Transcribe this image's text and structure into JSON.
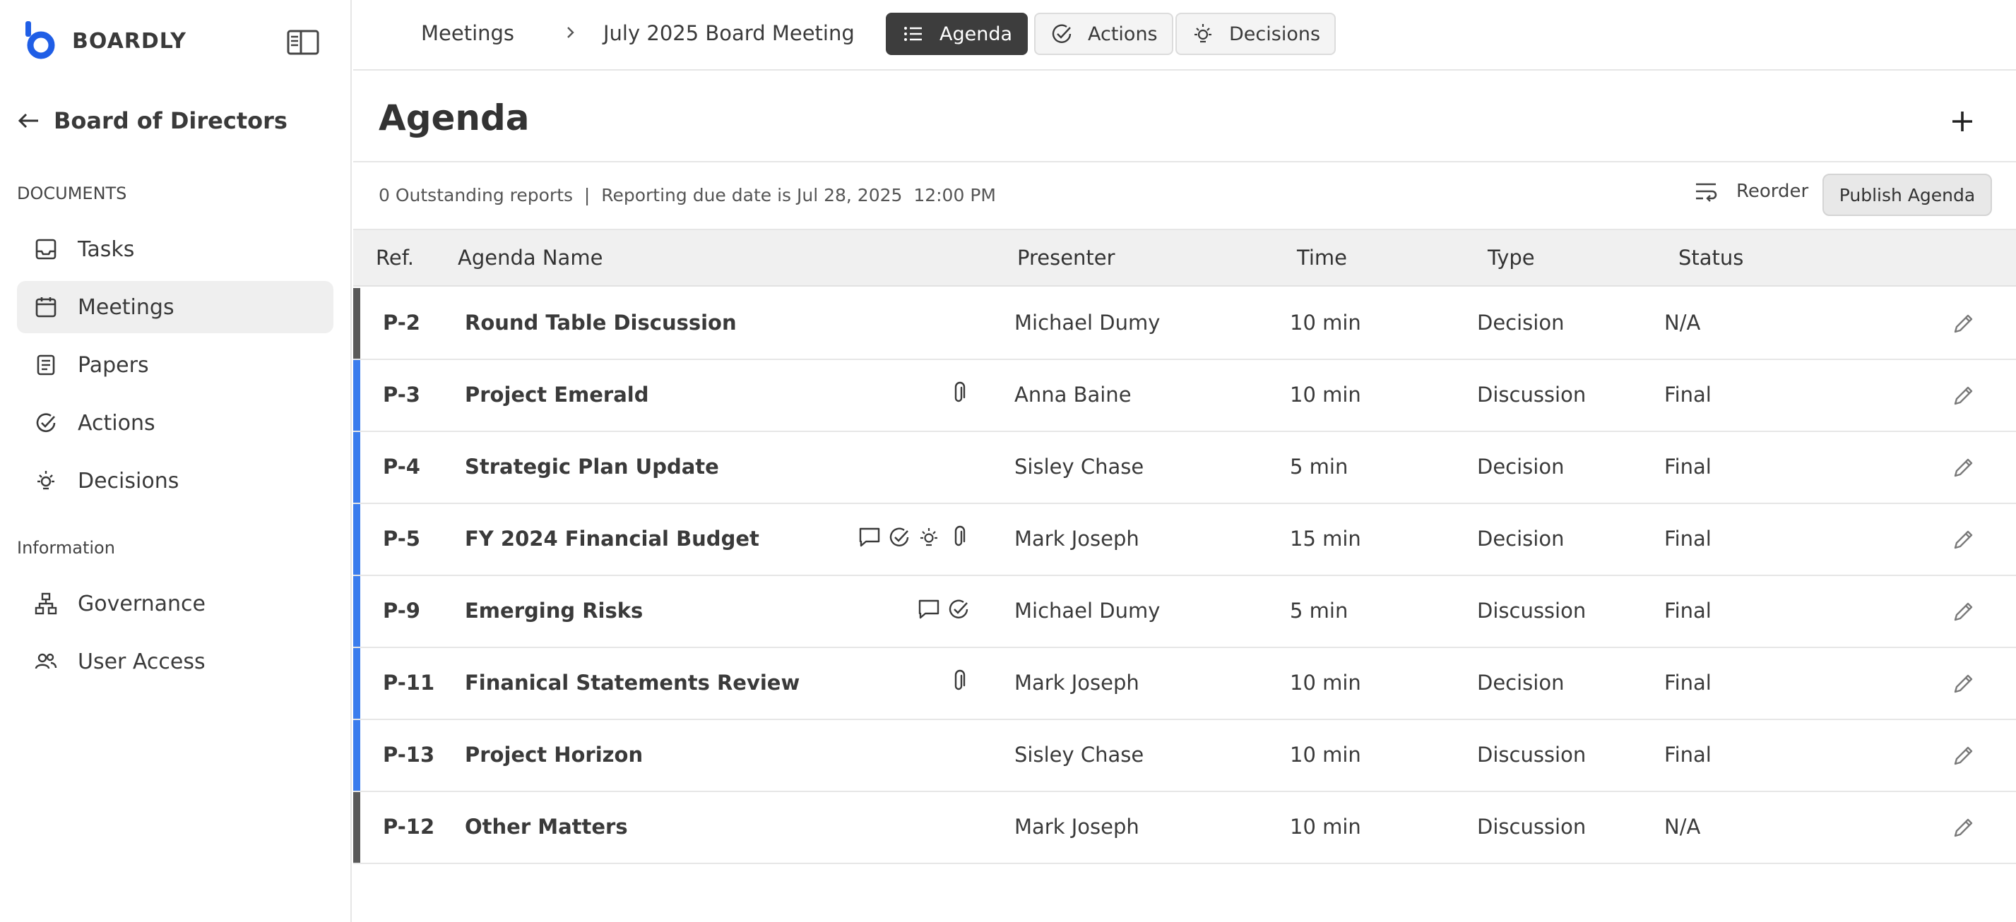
{
  "app": {
    "brand": "BOARDLY"
  },
  "sidebar": {
    "board_title": "Board of Directors",
    "sections": [
      {
        "label": "DOCUMENTS"
      },
      {
        "label": "Information"
      }
    ],
    "items": [
      {
        "label": "Tasks",
        "icon": "inbox-icon"
      },
      {
        "label": "Meetings",
        "icon": "calendar-icon",
        "active": true
      },
      {
        "label": "Papers",
        "icon": "document-icon"
      },
      {
        "label": "Actions",
        "icon": "check-circle-icon"
      },
      {
        "label": "Decisions",
        "icon": "lightbulb-icon"
      },
      {
        "label": "Governance",
        "icon": "org-chart-icon"
      },
      {
        "label": "User Access",
        "icon": "users-icon"
      }
    ]
  },
  "topbar": {
    "breadcrumb": [
      "Meetings",
      "July 2025 Board Meeting"
    ],
    "tabs": [
      {
        "label": "Agenda",
        "icon": "list-icon",
        "active": true
      },
      {
        "label": "Actions",
        "icon": "check-circle-icon"
      },
      {
        "label": "Decisions",
        "icon": "lightbulb-icon"
      }
    ]
  },
  "page": {
    "title": "Agenda",
    "info": "0 Outstanding reports  |  Reporting due date is Jul 28, 2025  12:00 PM",
    "reorder_label": "Reorder",
    "publish_label": "Publish Agenda"
  },
  "table": {
    "columns": [
      "Ref.",
      "Agenda Name",
      "Presenter",
      "Time",
      "Type",
      "Status"
    ],
    "rows": [
      {
        "ref": "P-2",
        "name": "Round Table Discussion",
        "presenter": "Michael Dumy",
        "time": "10 min",
        "type": "Decision",
        "status": "N/A",
        "bar": "#5a5a5a",
        "icons": []
      },
      {
        "ref": "P-3",
        "name": "Project Emerald",
        "presenter": "Anna Baine",
        "time": "10 min",
        "type": "Discussion",
        "status": "Final",
        "bar": "#3b7ded",
        "icons": [
          "paperclip-icon"
        ]
      },
      {
        "ref": "P-4",
        "name": "Strategic Plan Update",
        "presenter": "Sisley Chase",
        "time": "5 min",
        "type": "Decision",
        "status": "Final",
        "bar": "#3b7ded",
        "icons": []
      },
      {
        "ref": "P-5",
        "name": "FY 2024 Financial Budget",
        "presenter": "Mark Joseph",
        "time": "15 min",
        "type": "Decision",
        "status": "Final",
        "bar": "#3b7ded",
        "icons": [
          "comment-icon",
          "check-circle-icon",
          "lightbulb-icon",
          "paperclip-icon"
        ]
      },
      {
        "ref": "P-9",
        "name": "Emerging Risks",
        "presenter": "Michael Dumy",
        "time": "5 min",
        "type": "Discussion",
        "status": "Final",
        "bar": "#3b7ded",
        "icons": [
          "comment-icon",
          "check-circle-icon"
        ]
      },
      {
        "ref": "P-11",
        "name": "Finanical Statements Review",
        "presenter": "Mark Joseph",
        "time": "10 min",
        "type": "Decision",
        "status": "Final",
        "bar": "#3b7ded",
        "icons": [
          "paperclip-icon"
        ]
      },
      {
        "ref": "P-13",
        "name": "Project Horizon",
        "presenter": "Sisley Chase",
        "time": "10 min",
        "type": "Discussion",
        "status": "Final",
        "bar": "#3b7ded",
        "icons": []
      },
      {
        "ref": "P-12",
        "name": "Other Matters",
        "presenter": "Mark Joseph",
        "time": "10 min",
        "type": "Discussion",
        "status": "N/A",
        "bar": "#5a5a5a",
        "icons": []
      }
    ]
  },
  "colors": {
    "accent": "#3b7ded",
    "brand": "#1f5ee6",
    "neutral_bar": "#5a5a5a",
    "active_tab": "#3d3d3d"
  }
}
